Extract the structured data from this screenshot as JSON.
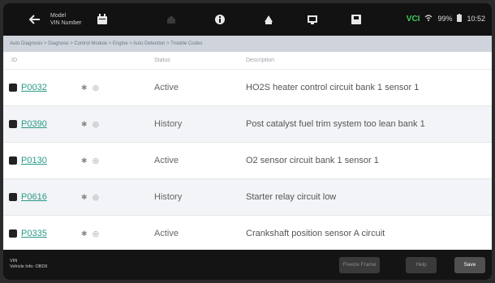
{
  "toolbar": {
    "vin_line1": "Model",
    "vin_line2": "VIN Number",
    "icons": [
      "back-icon",
      "car-icon",
      "calendar-icon",
      "home-icon",
      "info-icon",
      "scan-icon",
      "screenshot-icon",
      "save-icon"
    ]
  },
  "status": {
    "vci": "VCI",
    "battery": "99%",
    "time": "10:52"
  },
  "breadcrumb": "Auto Diagnosis > Diagnose > Control Module > Engine > Auto Detection > Trouble Codes",
  "table": {
    "headers": [
      "ID",
      "Status",
      "Description"
    ],
    "rows": [
      {
        "code": "P0032",
        "status": "Active",
        "description": "HO2S heater control circuit bank 1 sensor 1"
      },
      {
        "code": "P0390",
        "status": "History",
        "description": "Post catalyst fuel trim system too lean bank 1"
      },
      {
        "code": "P0130",
        "status": "Active",
        "description": "O2 sensor circuit bank 1 sensor 1"
      },
      {
        "code": "P0616",
        "status": "History",
        "description": "Starter relay circuit low"
      },
      {
        "code": "P0335",
        "status": "Active",
        "description": "Crankshaft position sensor A circuit"
      }
    ]
  },
  "footer": {
    "info_line1": "VIN",
    "info_line2": "Vehicle Info: OBDII",
    "buttons": [
      "Freeze Frame",
      "Help",
      "Save"
    ]
  },
  "colors": {
    "accent": "#2a9a86",
    "toolbar": "#121212",
    "breadcrumb_bg": "#cfd4dc"
  }
}
